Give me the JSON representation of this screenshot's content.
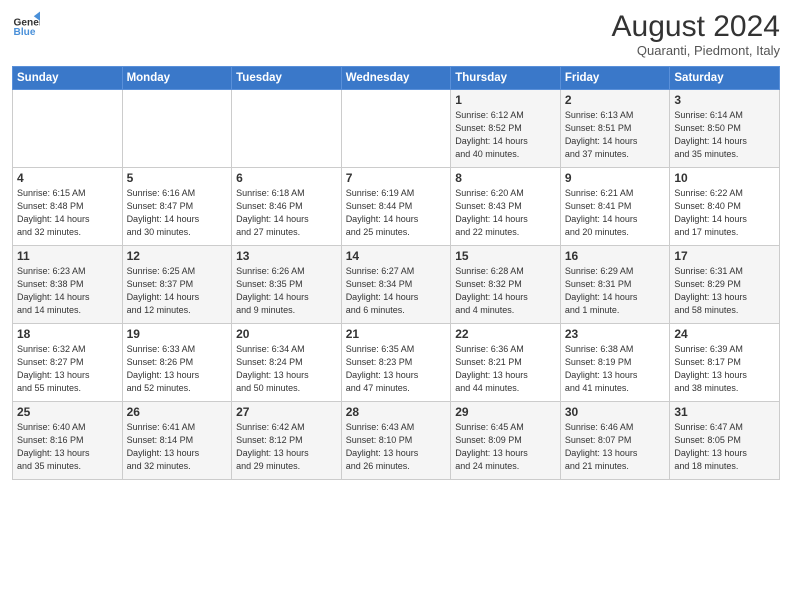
{
  "logo": {
    "line1": "General",
    "line2": "Blue"
  },
  "title": "August 2024",
  "location": "Quaranti, Piedmont, Italy",
  "days_of_week": [
    "Sunday",
    "Monday",
    "Tuesday",
    "Wednesday",
    "Thursday",
    "Friday",
    "Saturday"
  ],
  "weeks": [
    [
      {
        "day": "",
        "info": ""
      },
      {
        "day": "",
        "info": ""
      },
      {
        "day": "",
        "info": ""
      },
      {
        "day": "",
        "info": ""
      },
      {
        "day": "1",
        "info": "Sunrise: 6:12 AM\nSunset: 8:52 PM\nDaylight: 14 hours\nand 40 minutes."
      },
      {
        "day": "2",
        "info": "Sunrise: 6:13 AM\nSunset: 8:51 PM\nDaylight: 14 hours\nand 37 minutes."
      },
      {
        "day": "3",
        "info": "Sunrise: 6:14 AM\nSunset: 8:50 PM\nDaylight: 14 hours\nand 35 minutes."
      }
    ],
    [
      {
        "day": "4",
        "info": "Sunrise: 6:15 AM\nSunset: 8:48 PM\nDaylight: 14 hours\nand 32 minutes."
      },
      {
        "day": "5",
        "info": "Sunrise: 6:16 AM\nSunset: 8:47 PM\nDaylight: 14 hours\nand 30 minutes."
      },
      {
        "day": "6",
        "info": "Sunrise: 6:18 AM\nSunset: 8:46 PM\nDaylight: 14 hours\nand 27 minutes."
      },
      {
        "day": "7",
        "info": "Sunrise: 6:19 AM\nSunset: 8:44 PM\nDaylight: 14 hours\nand 25 minutes."
      },
      {
        "day": "8",
        "info": "Sunrise: 6:20 AM\nSunset: 8:43 PM\nDaylight: 14 hours\nand 22 minutes."
      },
      {
        "day": "9",
        "info": "Sunrise: 6:21 AM\nSunset: 8:41 PM\nDaylight: 14 hours\nand 20 minutes."
      },
      {
        "day": "10",
        "info": "Sunrise: 6:22 AM\nSunset: 8:40 PM\nDaylight: 14 hours\nand 17 minutes."
      }
    ],
    [
      {
        "day": "11",
        "info": "Sunrise: 6:23 AM\nSunset: 8:38 PM\nDaylight: 14 hours\nand 14 minutes."
      },
      {
        "day": "12",
        "info": "Sunrise: 6:25 AM\nSunset: 8:37 PM\nDaylight: 14 hours\nand 12 minutes."
      },
      {
        "day": "13",
        "info": "Sunrise: 6:26 AM\nSunset: 8:35 PM\nDaylight: 14 hours\nand 9 minutes."
      },
      {
        "day": "14",
        "info": "Sunrise: 6:27 AM\nSunset: 8:34 PM\nDaylight: 14 hours\nand 6 minutes."
      },
      {
        "day": "15",
        "info": "Sunrise: 6:28 AM\nSunset: 8:32 PM\nDaylight: 14 hours\nand 4 minutes."
      },
      {
        "day": "16",
        "info": "Sunrise: 6:29 AM\nSunset: 8:31 PM\nDaylight: 14 hours\nand 1 minute."
      },
      {
        "day": "17",
        "info": "Sunrise: 6:31 AM\nSunset: 8:29 PM\nDaylight: 13 hours\nand 58 minutes."
      }
    ],
    [
      {
        "day": "18",
        "info": "Sunrise: 6:32 AM\nSunset: 8:27 PM\nDaylight: 13 hours\nand 55 minutes."
      },
      {
        "day": "19",
        "info": "Sunrise: 6:33 AM\nSunset: 8:26 PM\nDaylight: 13 hours\nand 52 minutes."
      },
      {
        "day": "20",
        "info": "Sunrise: 6:34 AM\nSunset: 8:24 PM\nDaylight: 13 hours\nand 50 minutes."
      },
      {
        "day": "21",
        "info": "Sunrise: 6:35 AM\nSunset: 8:23 PM\nDaylight: 13 hours\nand 47 minutes."
      },
      {
        "day": "22",
        "info": "Sunrise: 6:36 AM\nSunset: 8:21 PM\nDaylight: 13 hours\nand 44 minutes."
      },
      {
        "day": "23",
        "info": "Sunrise: 6:38 AM\nSunset: 8:19 PM\nDaylight: 13 hours\nand 41 minutes."
      },
      {
        "day": "24",
        "info": "Sunrise: 6:39 AM\nSunset: 8:17 PM\nDaylight: 13 hours\nand 38 minutes."
      }
    ],
    [
      {
        "day": "25",
        "info": "Sunrise: 6:40 AM\nSunset: 8:16 PM\nDaylight: 13 hours\nand 35 minutes."
      },
      {
        "day": "26",
        "info": "Sunrise: 6:41 AM\nSunset: 8:14 PM\nDaylight: 13 hours\nand 32 minutes."
      },
      {
        "day": "27",
        "info": "Sunrise: 6:42 AM\nSunset: 8:12 PM\nDaylight: 13 hours\nand 29 minutes."
      },
      {
        "day": "28",
        "info": "Sunrise: 6:43 AM\nSunset: 8:10 PM\nDaylight: 13 hours\nand 26 minutes."
      },
      {
        "day": "29",
        "info": "Sunrise: 6:45 AM\nSunset: 8:09 PM\nDaylight: 13 hours\nand 24 minutes."
      },
      {
        "day": "30",
        "info": "Sunrise: 6:46 AM\nSunset: 8:07 PM\nDaylight: 13 hours\nand 21 minutes."
      },
      {
        "day": "31",
        "info": "Sunrise: 6:47 AM\nSunset: 8:05 PM\nDaylight: 13 hours\nand 18 minutes."
      }
    ]
  ]
}
